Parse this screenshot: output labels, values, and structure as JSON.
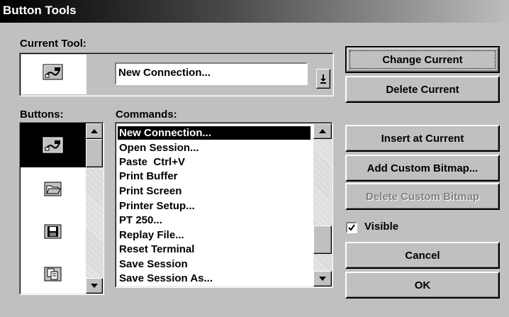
{
  "window": {
    "title": "Button Tools"
  },
  "current_tool": {
    "label": "Current Tool:",
    "command_value": "New Connection..."
  },
  "buttons_list": {
    "label": "Buttons:",
    "items": [
      {
        "icon": "connection-icon"
      },
      {
        "icon": "open-folder-icon"
      },
      {
        "icon": "save-disk-icon"
      },
      {
        "icon": "copy-pages-icon"
      }
    ]
  },
  "commands_list": {
    "label": "Commands:",
    "items": [
      "New Connection...",
      "Open Session...",
      "Paste  Ctrl+V",
      "Print Buffer",
      "Print Screen",
      "Printer Setup...",
      "PT 250...",
      "Replay File...",
      "Reset Terminal",
      "Save Session",
      "Save Session As..."
    ]
  },
  "actions": {
    "change_current": "Change Current",
    "delete_current": "Delete Current",
    "insert_at_current": "Insert at Current",
    "add_custom_bitmap": "Add Custom Bitmap...",
    "delete_custom_bitmap": "Delete Custom Bitmap",
    "visible": "Visible",
    "visible_checked": true,
    "cancel": "Cancel",
    "ok": "OK"
  },
  "colors": {
    "face": "#c0c0c0",
    "selection": "#000000",
    "disabled_text": "#808080"
  }
}
